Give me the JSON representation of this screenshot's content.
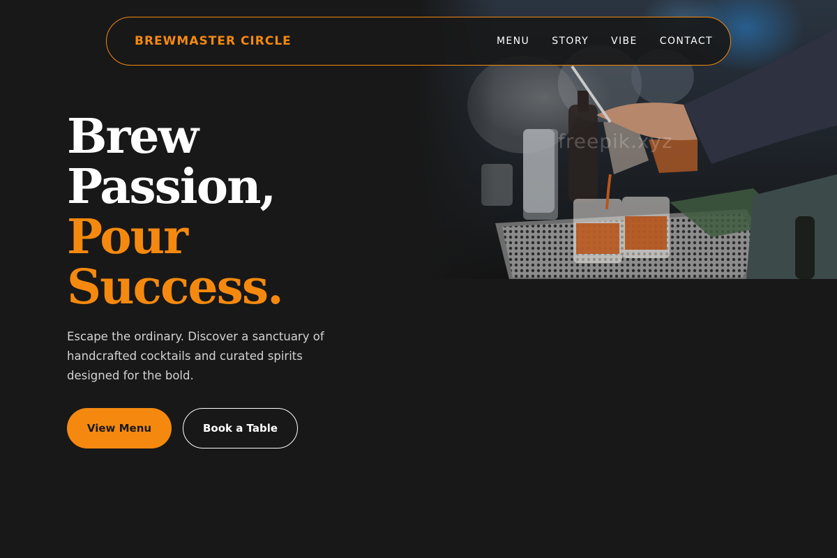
{
  "nav": {
    "brand": "BREWMASTER CIRCLE",
    "links": [
      "MENU",
      "STORY",
      "VIBE",
      "CONTACT"
    ]
  },
  "hero": {
    "headline": {
      "line1": "Brew",
      "line2": "Passion,",
      "line3": "Pour",
      "line4": "Success."
    },
    "lead": "Escape the ordinary. Discover a sanctuary of handcrafted cocktails and curated spirits designed for the bold.",
    "primary_button": "View Menu",
    "secondary_button": "Book a Table",
    "image_watermark": "freepik.xyz"
  },
  "colors": {
    "background": "#181818",
    "accent": "#f5890f",
    "text": "#ffffff",
    "muted_text": "#d4d4d4"
  }
}
